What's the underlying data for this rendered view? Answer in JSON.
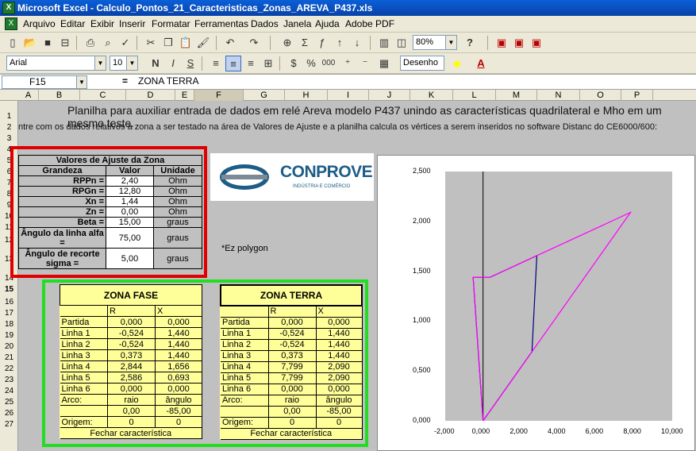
{
  "window": {
    "title": "Microsoft Excel - Calculo_Pontos_21_Caracteristicas_Zonas_AREVA_P437.xls"
  },
  "menu": [
    "Arquivo",
    "Editar",
    "Exibir",
    "Inserir",
    "Formatar",
    "Ferramentas",
    "Dados",
    "Janela",
    "Ajuda",
    "Adobe PDF"
  ],
  "toolbar": {
    "zoom": "80%",
    "help": "?"
  },
  "format_toolbar": {
    "font": "Arial",
    "size": "10",
    "bold": "N",
    "italic": "I",
    "underline": "S",
    "comma": "%",
    "thousands": "000",
    "desenho": "Desenho",
    "font_color_letter": "A"
  },
  "formula_bar": {
    "cell": "F15",
    "eq": "=",
    "value": "ZONA TERRA"
  },
  "columns": [
    "A",
    "B",
    "C",
    "D",
    "E",
    "F",
    "G",
    "H",
    "I",
    "J",
    "K",
    "L",
    "M",
    "N",
    "O",
    "P"
  ],
  "rows": [
    "1",
    "2",
    "3",
    "4",
    "5",
    "6",
    "7",
    "8",
    "9",
    "10",
    "11",
    "12",
    "13",
    "14",
    "15",
    "16",
    "17",
    "18",
    "19",
    "20",
    "21",
    "22",
    "23",
    "24",
    "25",
    "26",
    "27"
  ],
  "sheet": {
    "title": "Planilha para auxiliar entrada de dados em relé Areva modelo P437 unindo as características quadrilateral e Mho em um mesmo teste.",
    "subtitle": "ntre com os dados relativos a zona a ser testado na área de Valores de Ajuste e a planilha calcula os vértices a serem inseridos no software Distanc do CE6000/600:",
    "note": "*Ez polygon",
    "logo": {
      "name": "CONPROVE",
      "tagline": "INDÚSTRIA E COMÉRCIO"
    }
  },
  "settings": {
    "title": "Valores de Ajuste da Zona",
    "headers": [
      "Grandeza",
      "Valor",
      "Unidade"
    ],
    "rows": [
      {
        "label": "RPPn =",
        "value": "2,40",
        "unit": "Ohm"
      },
      {
        "label": "RPGn =",
        "value": "12,80",
        "unit": "Ohm"
      },
      {
        "label": "Xn =",
        "value": "1,44",
        "unit": "Ohm"
      },
      {
        "label": "Zn =",
        "value": "0,00",
        "unit": "Ohm"
      },
      {
        "label": "Beta =",
        "value": "15,00",
        "unit": "graus"
      },
      {
        "label": "Ângulo da linha alfa =",
        "value": "75,00",
        "unit": "graus"
      },
      {
        "label": "Ângulo de recorte sigma =",
        "value": "5,00",
        "unit": "graus"
      }
    ]
  },
  "zona_fase": {
    "title": "ZONA FASE",
    "h1": "R",
    "h2": "X",
    "rows": [
      [
        "Partida",
        "0,000",
        "0,000"
      ],
      [
        "Linha 1",
        "-0,524",
        "1,440"
      ],
      [
        "Linha 2",
        "-0,524",
        "1,440"
      ],
      [
        "Linha 3",
        "0,373",
        "1,440"
      ],
      [
        "Linha 4",
        "2,844",
        "1,656"
      ],
      [
        "Linha 5",
        "2,586",
        "0,693"
      ],
      [
        "Linha 6",
        "0,000",
        "0,000"
      ],
      [
        "Arco:",
        "raio",
        "ângulo"
      ],
      [
        "",
        "0,00",
        "-85,00"
      ],
      [
        "Origem:",
        "0",
        "0"
      ]
    ],
    "footer": "Fechar característica"
  },
  "zona_terra": {
    "title": "ZONA TERRA",
    "h1": "R",
    "h2": "X",
    "rows": [
      [
        "Partida",
        "0,000",
        "0,000"
      ],
      [
        "Linha 1",
        "-0,524",
        "1,440"
      ],
      [
        "Linha 2",
        "-0,524",
        "1,440"
      ],
      [
        "Linha 3",
        "0,373",
        "1,440"
      ],
      [
        "Linha 4",
        "7,799",
        "2,090"
      ],
      [
        "Linha 5",
        "7,799",
        "2,090"
      ],
      [
        "Linha 6",
        "0,000",
        "0,000"
      ],
      [
        "Arco:",
        "raio",
        "ângulo"
      ],
      [
        "",
        "0,00",
        "-85,00"
      ],
      [
        "Origem:",
        "0",
        "0"
      ]
    ],
    "footer": "Fechar característica"
  },
  "chart_data": {
    "type": "scatter",
    "xlim": [
      -2,
      10
    ],
    "ylim": [
      0,
      2.5
    ],
    "xticks": [
      "-2,000",
      "0,000",
      "2,000",
      "4,000",
      "6,000",
      "8,000",
      "10,000"
    ],
    "yticks": [
      "0,000",
      "0,500",
      "1,000",
      "1,500",
      "2,000",
      "2,500"
    ],
    "series": [
      {
        "color": "#000080",
        "x": [
          0,
          -0.524,
          -0.524,
          0.373,
          2.844,
          2.586,
          0
        ],
        "y": [
          0,
          1.44,
          1.44,
          1.44,
          1.656,
          0.693,
          0
        ]
      },
      {
        "color": "#ff00ff",
        "x": [
          0,
          -0.524,
          -0.524,
          0.373,
          7.799,
          7.799,
          0
        ],
        "y": [
          0,
          1.44,
          1.44,
          1.44,
          2.09,
          2.09,
          0
        ]
      }
    ]
  }
}
